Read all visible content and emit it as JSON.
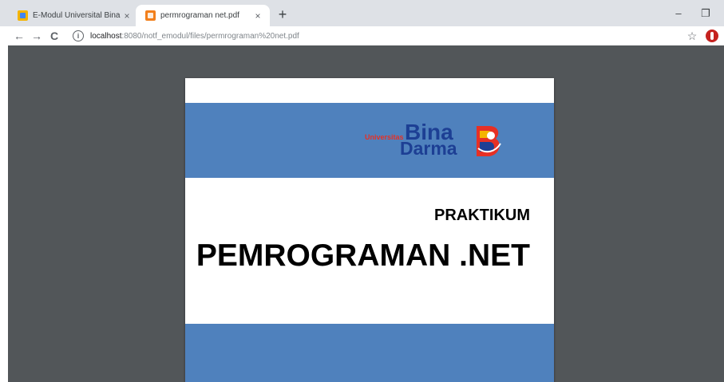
{
  "tabs": [
    {
      "title": "E-Modul Universital Bina Darma",
      "close": "×",
      "active": false
    },
    {
      "title": "permrograman net.pdf",
      "close": "×",
      "active": true
    }
  ],
  "new_tab": "+",
  "window_controls": {
    "minimize": "–",
    "restore": "❐"
  },
  "nav": {
    "back": "←",
    "forward": "→",
    "reload": "C"
  },
  "address": {
    "host": "localhost",
    "path": ":8080/notf_emodul/files/permrograman%20net.pdf"
  },
  "icons": {
    "info": "i",
    "star": "☆"
  },
  "pdf": {
    "logo": {
      "small": "Universitas",
      "line1": "Bina",
      "line2": "Darma"
    },
    "praktikum": "PRAKTIKUM",
    "title": "PEMROGRAMAN .NET"
  },
  "colors": {
    "band": "#4f81bd",
    "viewer_bg": "#525659",
    "logo_blue": "#1d3f94",
    "logo_red": "#e63025"
  }
}
